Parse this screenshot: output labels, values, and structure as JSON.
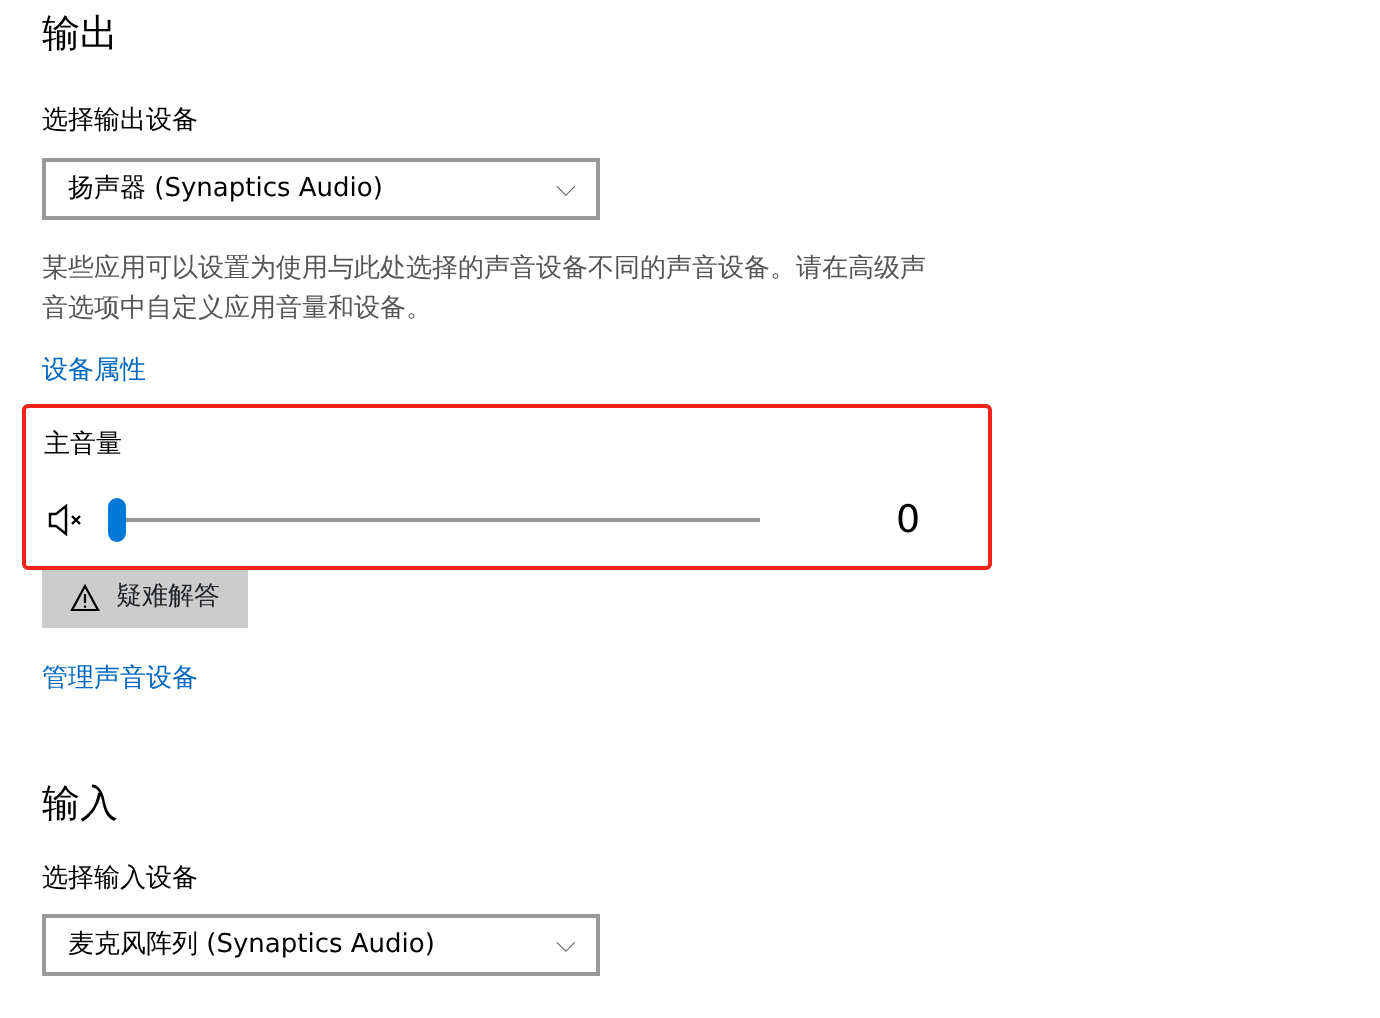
{
  "output": {
    "heading": "输出",
    "device_label": "选择输出设备",
    "device": {
      "value": "扬声器 (Synaptics Audio)",
      "caret": "⌵"
    },
    "description": "某些应用可以设置为使用与此处选择的声音设备不同的声音设备。请在高级声音选项中自定义应用音量和设备。",
    "properties_link": "设备属性",
    "volume": {
      "highlighted": true,
      "label": "主音量",
      "muted": true,
      "level": 0,
      "reading": "0"
    },
    "troubleshoot_button": "疑难解答",
    "manage_link": "管理声音设备"
  },
  "input": {
    "heading": "输入",
    "device_label": "选择输入设备",
    "device": {
      "value": "麦克风阵列 (Synaptics Audio)",
      "caret": "⌵"
    }
  }
}
